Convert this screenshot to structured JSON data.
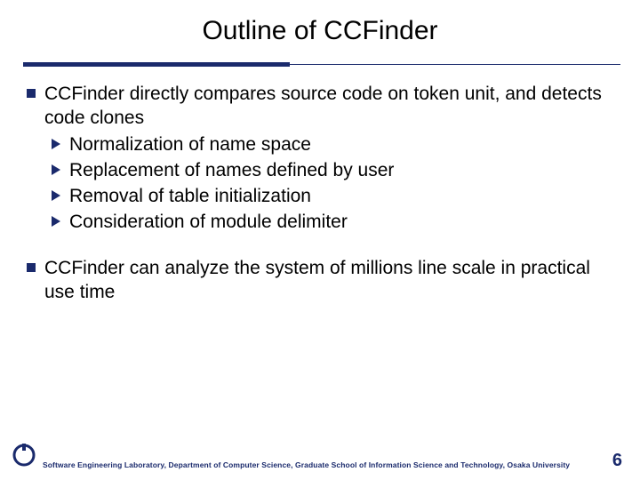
{
  "title": "Outline of CCFinder",
  "points": [
    {
      "text": "CCFinder directly compares source code on token unit, and detects code clones",
      "subs": [
        "Normalization of name space",
        "Replacement of names defined by user",
        "Removal of table initialization",
        "Consideration of module delimiter"
      ]
    },
    {
      "text": "CCFinder can analyze the system of millions line scale in practical use time",
      "subs": []
    }
  ],
  "footer": {
    "affiliation": "Software Engineering Laboratory, Department of Computer Science, Graduate School of Information Science and Technology, Osaka University",
    "page": "6"
  },
  "colors": {
    "accent": "#1a2a6c"
  }
}
